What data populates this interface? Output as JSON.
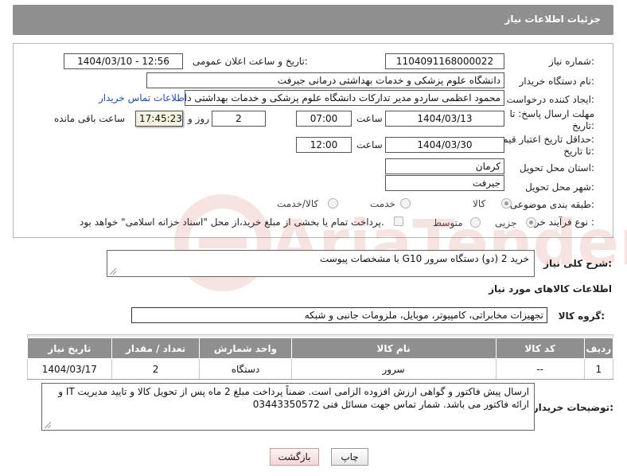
{
  "page": {
    "title": "جزئیات اطلاعات نیاز"
  },
  "form": {
    "need_number": {
      "label": "شماره نیاز:",
      "value": "1104091168000022"
    },
    "announce": {
      "label": "تاریخ و ساعت اعلان عمومی:",
      "value": "1404/03/10 - 12:56"
    },
    "buyer_org": {
      "label": "نام دستگاه خریدار:",
      "value": "دانشگاه علوم پزشکی و خدمات بهداشتی درمانی جیرفت"
    },
    "requester": {
      "label": "ایجاد کننده درخواست:",
      "value": "محمود اعظمی ساردو مدیر تدارکات دانشگاه علوم پزشکی و خدمات بهداشتی د",
      "link": "اطلاعات تماس خریدار"
    },
    "deadline": {
      "label_line1": "مهلت ارسال پاسخ: تا",
      "label_line2": "تاریخ:",
      "date": "1404/03/13",
      "time_label": "ساعت",
      "time": "07:00",
      "days": "2",
      "days_label": "روز و",
      "remaining": "17:45:23",
      "remaining_label": "ساعت باقی مانده"
    },
    "min_price": {
      "label_line1": "حداقل تاریخ اعتبار قیمت:",
      "label_line2": "تا تاریخ:",
      "date": "1404/03/30",
      "time_label": "ساعت",
      "time": "12:00"
    },
    "province": {
      "label": "استان محل تحویل:",
      "value": "کرمان"
    },
    "city": {
      "label": "شهر محل تحویل:",
      "value": "جیرفت"
    },
    "category": {
      "label": "طبقه بندی موضوعی:",
      "options": [
        "کالا",
        "خدمت",
        "کالا/خدمت"
      ],
      "selected": "کالا"
    },
    "purchase_type": {
      "label": "نوع فرآیند خرید :",
      "options": [
        "جزیی",
        "متوسط"
      ],
      "selected": "جزیی",
      "note": "پرداخت تمام یا بخشی از مبلغ خرید،از محل \"اسناد خزانه اسلامی\" خواهد بود."
    }
  },
  "watermark": "AriaTender.net",
  "summary": {
    "label": "شرح کلی نیاز:",
    "value": "خرید 2 (دو) دستگاه سرور G10 با مشخصات پیوست"
  },
  "items_section": {
    "title": "اطلاعات کالاهای مورد نیاز",
    "group_label": "گروه کالا:",
    "group_value": "تجهیزات مخابراتی، کامپیوتر، موبایل، ملزومات جانبی و شبکه"
  },
  "table": {
    "headers": [
      "ردیف",
      "کد کالا",
      "نام کالا",
      "واحد شمارش",
      "تعداد / مقدار",
      "تاریخ نیاز"
    ],
    "rows": [
      [
        "1",
        "--",
        "سرور",
        "دستگاه",
        "2",
        "1404/03/17"
      ]
    ]
  },
  "buyer_notes": {
    "label": "توضیحات خریدار:",
    "value": "ارسال پیش فاکتور و گواهی ارزش افزوده الزامی است. ضمناً پرداخت مبلغ 2 ماه پس از تحویل کالا و تایید مدیریت IT و ارائه فاکتور می باشد. شمار تماس جهت مسائل فنی 03443350572"
  },
  "buttons": {
    "print": "چاپ",
    "back": "بازگشت"
  }
}
